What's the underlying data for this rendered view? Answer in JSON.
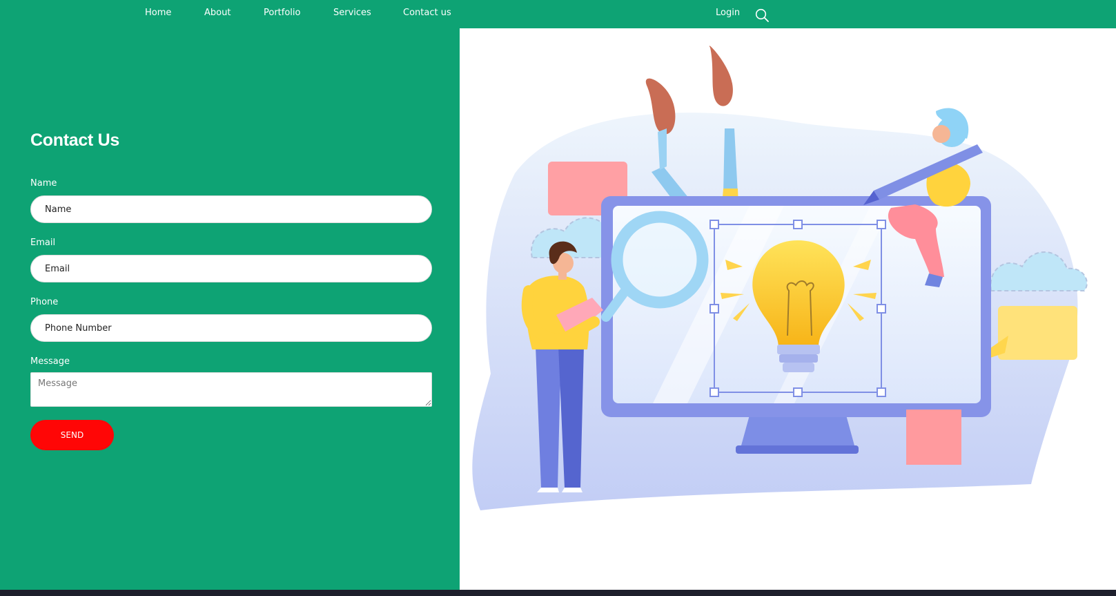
{
  "nav": {
    "links": [
      "Home",
      "About",
      "Portfolio",
      "Services",
      "Contact us"
    ],
    "login": "Login",
    "search_icon": "search-icon"
  },
  "contact": {
    "title": "Contact Us",
    "name": {
      "label": "Name",
      "placeholder": "Name"
    },
    "email": {
      "label": "Email",
      "placeholder": "Email"
    },
    "phone": {
      "label": "Phone",
      "placeholder": "Phone Number"
    },
    "message": {
      "label": "Message",
      "placeholder": "Message"
    },
    "send": "SEND"
  },
  "colors": {
    "brand_green": "#0ea374",
    "send_red": "#ff0606",
    "footer_dark": "#1e1f2c"
  },
  "hero": {
    "image": "illustration-idea-lightbulb-monitor"
  }
}
